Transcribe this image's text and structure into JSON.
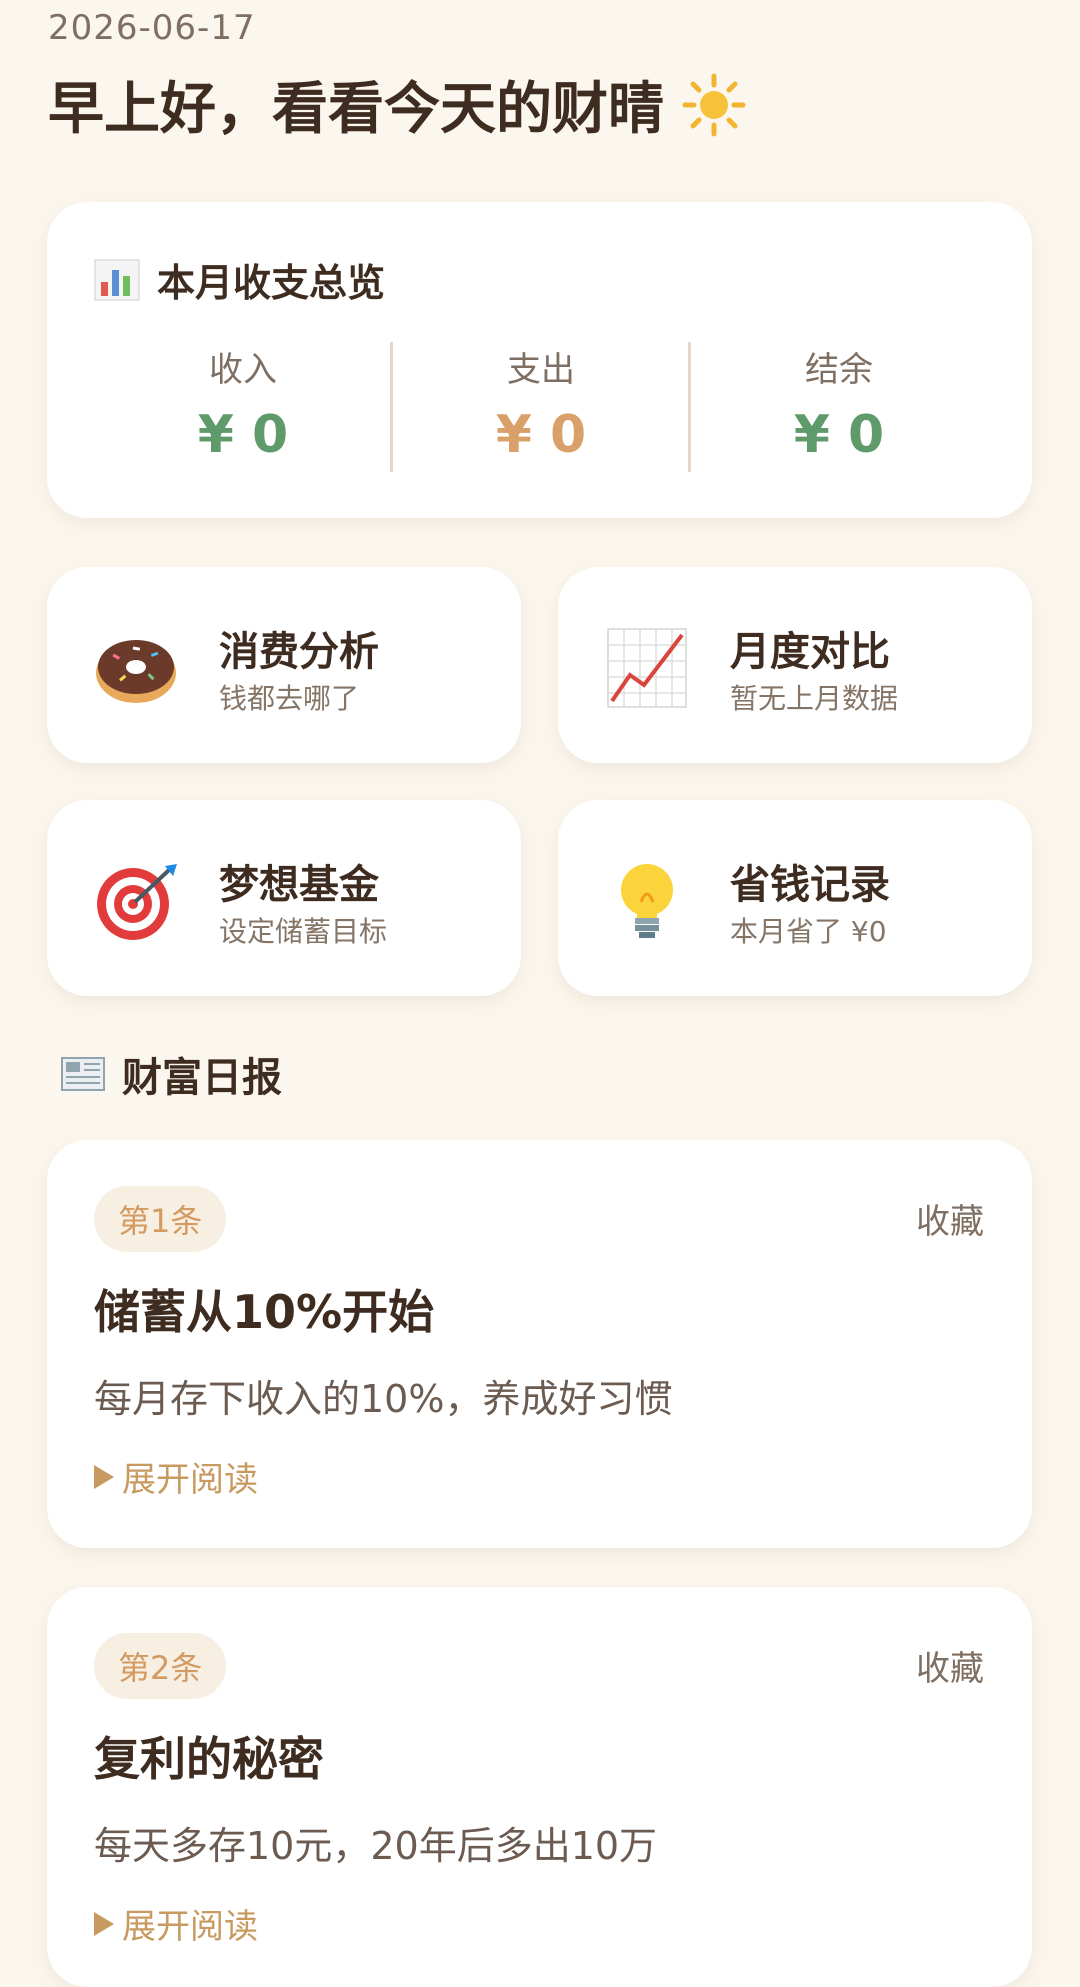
{
  "header": {
    "date": "2026-06-17",
    "greeting": "早上好，看看今天的财晴"
  },
  "overview": {
    "title": "本月收支总览",
    "income_label": "收入",
    "income_value": "¥ 0",
    "expense_label": "支出",
    "expense_value": "¥ 0",
    "balance_label": "结余",
    "balance_value": "¥ 0"
  },
  "tiles": [
    {
      "title": "消费分析",
      "subtitle": "钱都去哪了",
      "icon": "donut-icon"
    },
    {
      "title": "月度对比",
      "subtitle": "暂无上月数据",
      "icon": "chart-up-icon"
    },
    {
      "title": "梦想基金",
      "subtitle": "设定储蓄目标",
      "icon": "target-icon"
    },
    {
      "title": "省钱记录",
      "subtitle": "本月省了 ¥0",
      "icon": "lightbulb-icon"
    }
  ],
  "section": {
    "title": "财富日报",
    "icon": "newspaper-icon"
  },
  "articles": [
    {
      "badge": "第1条",
      "favorite": "收藏",
      "title": "储蓄从10%开始",
      "body": "每月存下收入的10%，养成好习惯",
      "more": "展开阅读"
    },
    {
      "badge": "第2条",
      "favorite": "收藏",
      "title": "复利的秘密",
      "body": "每天多存10元，20年后多出10万",
      "more": "展开阅读"
    }
  ],
  "colors": {
    "background": "#fcf7ee",
    "income": "#5f9a6a",
    "expense": "#d9a06a",
    "accent": "#c89a60"
  }
}
